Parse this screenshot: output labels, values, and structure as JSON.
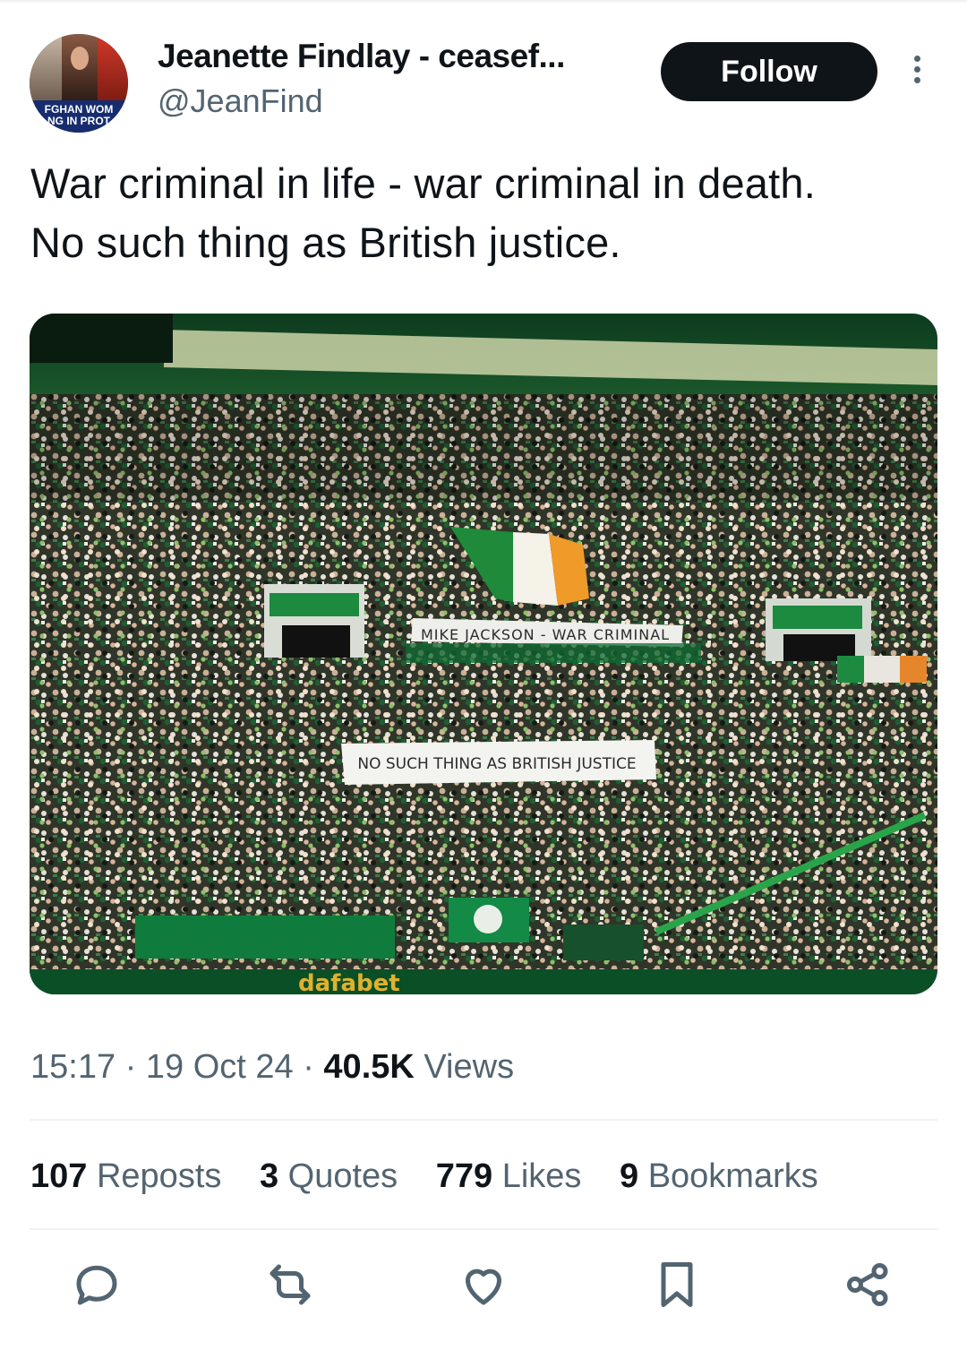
{
  "author": {
    "display_name": "Jeanette Findlay - ceasef...",
    "handle": "@JeanFind",
    "avatar_banner_line1": "FGHAN WOM",
    "avatar_banner_line2": "NG IN PROT"
  },
  "follow_label": "Follow",
  "more_icon": "more-dots-icon",
  "tweet": {
    "text_line1": "War criminal in life - war criminal in death.",
    "text_line2": "No such thing as British justice."
  },
  "photo": {
    "banner1": "MIKE JACKSON - WAR CRIMINAL",
    "banner2": "NO SUCH THING AS BRITISH JUSTICE",
    "pitch_ad": "dafabet"
  },
  "meta": {
    "time": "15:17",
    "date": "19 Oct 24",
    "separator": "·",
    "views_count": "40.5K",
    "views_label": "Views"
  },
  "stats": [
    {
      "count": "107",
      "label": "Reposts"
    },
    {
      "count": "3",
      "label": "Quotes"
    },
    {
      "count": "779",
      "label": "Likes"
    },
    {
      "count": "9",
      "label": "Bookmarks"
    }
  ],
  "actions": [
    "reply-icon",
    "repost-icon",
    "like-icon",
    "bookmark-icon",
    "share-icon"
  ],
  "colors": {
    "text": "#0f1419",
    "secondary": "#536471",
    "divider": "#eff3f4",
    "follow_bg": "#0f1419",
    "celtic_green": "#0b7a3e"
  }
}
